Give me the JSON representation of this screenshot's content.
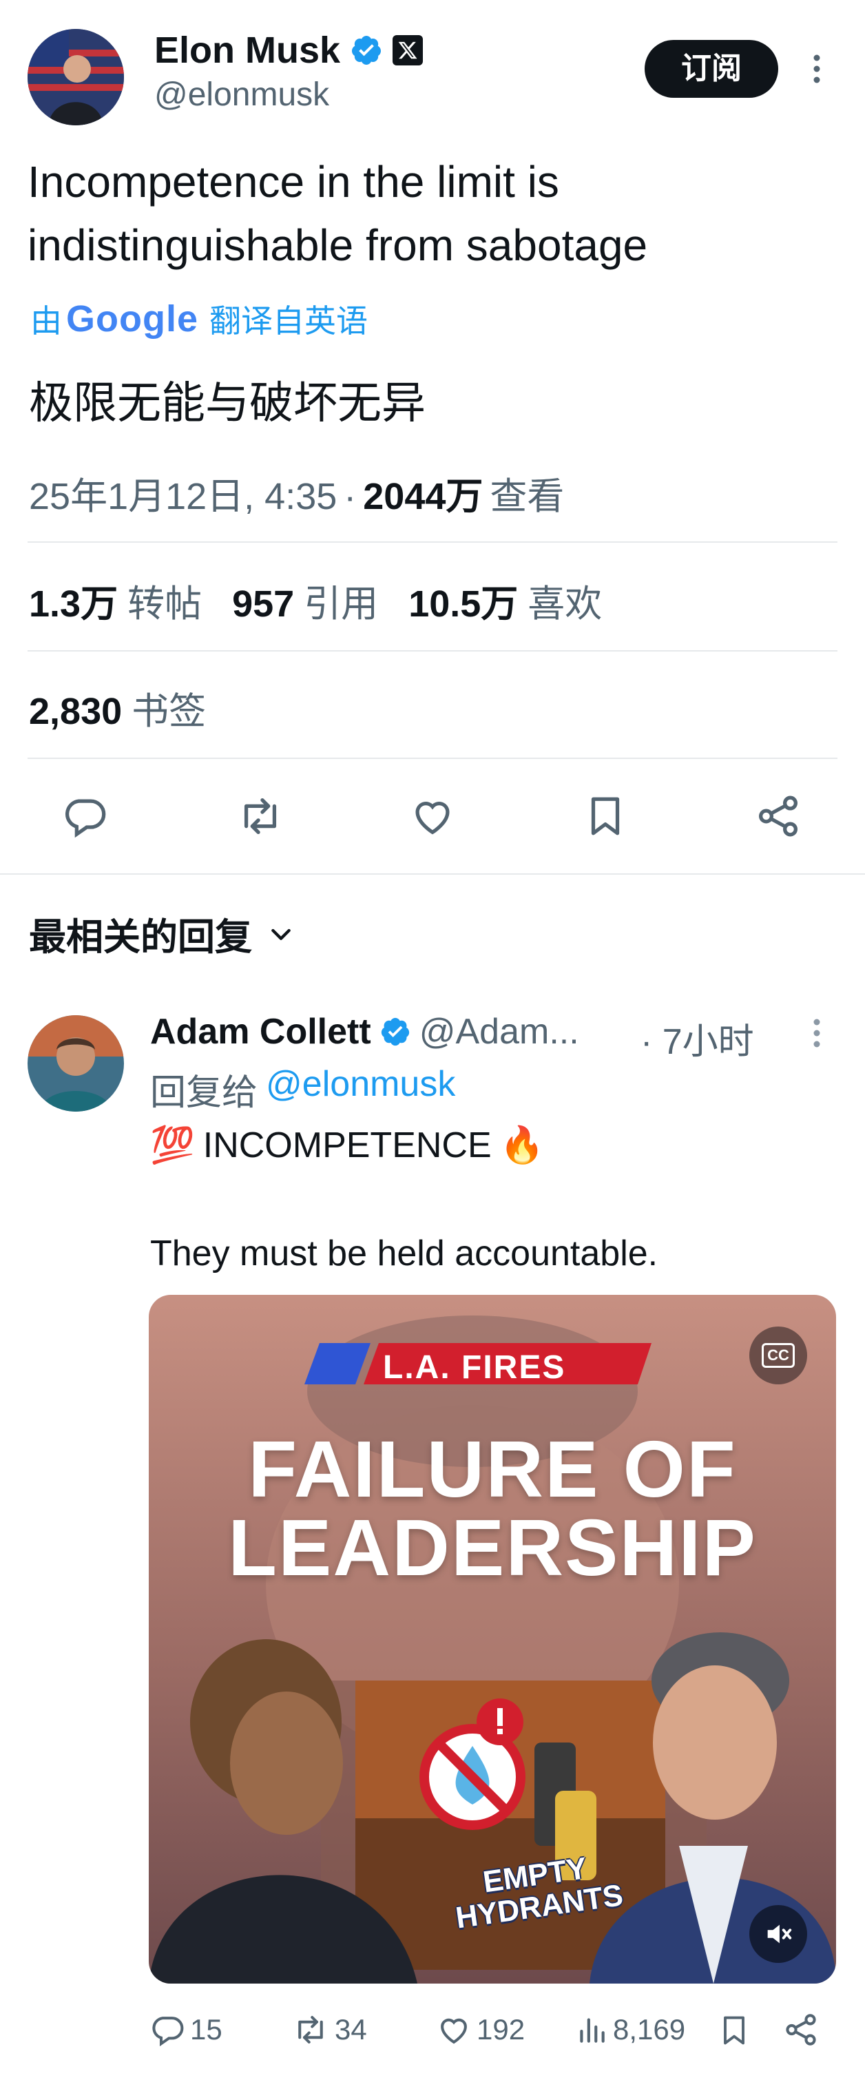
{
  "post": {
    "author_name": "Elon Musk",
    "author_handle": "@elonmusk",
    "subscribe_label": "订阅",
    "text": "Incompetence in the limit is indistinguishable from sabotage",
    "translated_prefix": "由",
    "translated_brand": "Google",
    "translated_suffix": "翻译自英语",
    "translation": "极限无能与破坏无异",
    "date": "25年1月12日, 4:35",
    "views_sep": "·",
    "views_count": "2044万",
    "views_label": "查看",
    "stats": {
      "reposts_num": "1.3万",
      "reposts_label": "转帖",
      "quotes_num": "957",
      "quotes_label": "引用",
      "likes_num": "10.5万",
      "likes_label": "喜欢",
      "bookmarks_num": "2,830",
      "bookmarks_label": "书签"
    }
  },
  "replies_header": {
    "label": "最相关的回复"
  },
  "reply": {
    "author_name": "Adam Collett",
    "author_handle": "@Adam...",
    "time": "· 7小时",
    "reply_to_prefix": "回复给",
    "reply_to_handle": "@elonmusk",
    "line1_emoji": "💯",
    "line1_text": "INCOMPETENCE",
    "line1_emoji2": "🔥",
    "line2": "They must be held accountable.",
    "media": {
      "banner": "L.A. FIRES",
      "headline_1": "FAILURE OF",
      "headline_2": "LEADERSHIP",
      "sign_line1": "EMPTY",
      "sign_line2": "HYDRANTS",
      "cc_label": "CC"
    },
    "actions": {
      "replies": "15",
      "reposts": "34",
      "likes": "192",
      "views": "8,169"
    }
  },
  "colors": {
    "text": "#0f1419",
    "muted": "#536471",
    "link": "#1d9bf0",
    "verified": "#1d9bf0",
    "banner_red": "#d21f2d"
  }
}
